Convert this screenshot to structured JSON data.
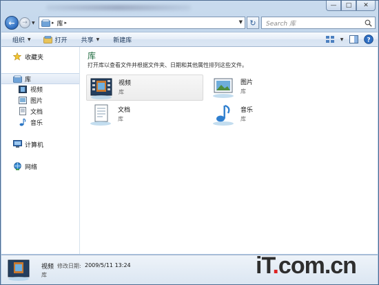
{
  "window": {
    "caption_minimize": "—",
    "caption_maximize": "□",
    "caption_close": "✕"
  },
  "address": {
    "breadcrumb": "库",
    "separator": "▸"
  },
  "search": {
    "placeholder": "Search 库"
  },
  "toolbar": {
    "organize": "组织",
    "open": "打开",
    "share": "共享",
    "new_library": "新建库"
  },
  "nav": {
    "favorites": "收藏夹",
    "libraries": "库",
    "videos": "视频",
    "pictures": "图片",
    "documents": "文档",
    "music": "音乐",
    "computer": "计算机",
    "network": "网络"
  },
  "main": {
    "title": "库",
    "description": "打开库以查看文件并根据文件夹、日期和其他属性排列这些文件。",
    "items": [
      {
        "name": "视频",
        "type": "库",
        "icon": "video-library-icon",
        "selected": true
      },
      {
        "name": "图片",
        "type": "库",
        "icon": "picture-library-icon",
        "selected": false
      },
      {
        "name": "文档",
        "type": "库",
        "icon": "document-library-icon",
        "selected": false
      },
      {
        "name": "音乐",
        "type": "库",
        "icon": "music-library-icon",
        "selected": false
      }
    ]
  },
  "details": {
    "name": "视频",
    "date_label": "修改日期:",
    "date_value": "2009/5/11 13:24",
    "type": "库"
  },
  "watermark": {
    "text_a": "iT",
    "text_b": "com.cn"
  },
  "colors": {
    "title_green": "#1f6b3f",
    "accent_blue": "#2c6bbf"
  }
}
